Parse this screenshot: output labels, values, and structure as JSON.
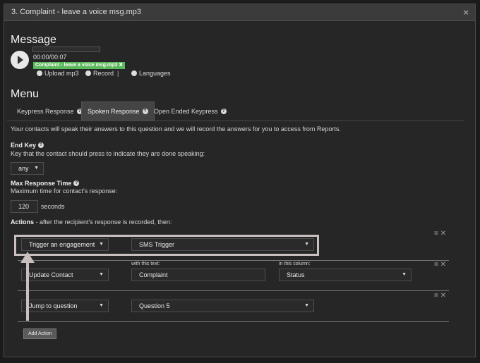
{
  "dialog": {
    "title": "3. Complaint - leave a voice msg.mp3",
    "close": "×"
  },
  "message": {
    "heading": "Message",
    "time": "00:00/00:07",
    "file_badge": "Complaint - leave a voice msg.mp3 ✖",
    "upload_label": "Upload mp3",
    "record_label": "Record",
    "separator": "|",
    "languages_label": "Languages"
  },
  "menu": {
    "heading": "Menu",
    "tabs": [
      {
        "label": "Keypress Response",
        "active": false
      },
      {
        "label": "Spoken Response",
        "active": true
      },
      {
        "label": "Open Ended Keypress",
        "active": false
      }
    ],
    "description": "Your contacts will speak their answers to this question and we will record the answers for you to access from Reports.",
    "end_key": {
      "label": "End Key",
      "help": "Key that the contact should press to indicate they are done speaking:",
      "value": "any"
    },
    "max_time": {
      "label": "Max Response Time",
      "help": "Maximum time for contact's response:",
      "value": "120",
      "unit": "seconds"
    },
    "actions": {
      "label": "Actions",
      "suffix": " - after the recipient's response is recorded, then:",
      "rows": [
        {
          "action": "Trigger an engagement",
          "target": "SMS Trigger"
        },
        {
          "action": "Update Contact",
          "text_label": "with this text:",
          "text_value": "Complaint",
          "column_label": "in this column:",
          "column_value": "Status"
        },
        {
          "action": "Jump to question",
          "target": "Question 5"
        }
      ],
      "add_label": "Add Action",
      "row_tools": "= ✕"
    }
  },
  "colors": {
    "background": "#262626",
    "titlebar": "#3b3b3b",
    "badge_green": "#5cb85c",
    "highlight_border": "#c9bfbf"
  }
}
